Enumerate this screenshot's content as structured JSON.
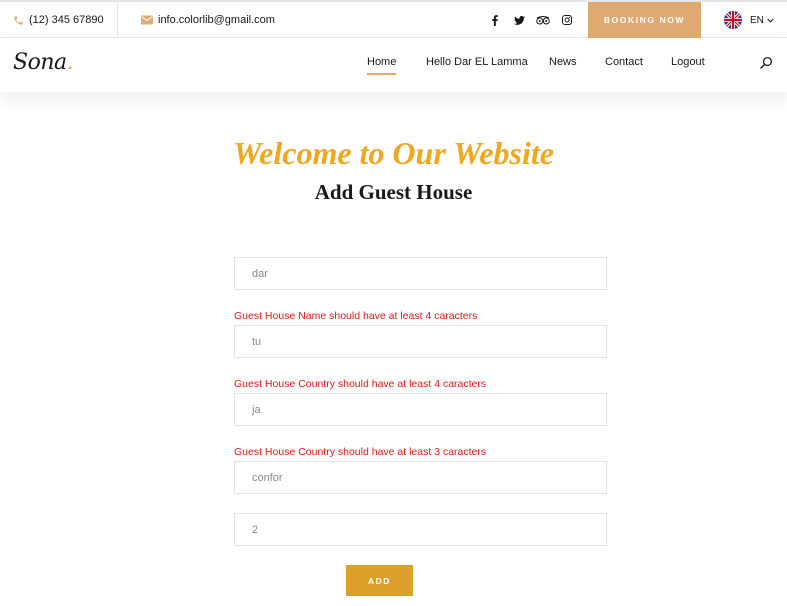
{
  "topbar": {
    "phone": "(12) 345 67890",
    "email": "info.colorlib@gmail.com",
    "social_icons": [
      "facebook-icon",
      "twitter-icon",
      "tripadvisor-icon",
      "instagram-icon"
    ],
    "booking_label": "BOOKING NOW",
    "language": "EN"
  },
  "nav": {
    "logo_text": "Sona",
    "logo_dot": ".",
    "items": [
      {
        "label": "Home",
        "active": true
      },
      {
        "label": "Hello Dar EL Lamma",
        "active": false
      },
      {
        "label": "News",
        "active": false
      },
      {
        "label": "Contact",
        "active": false
      },
      {
        "label": "Logout",
        "active": false
      }
    ]
  },
  "page": {
    "welcome": "Welcome to Our Website",
    "title": "Add Guest House"
  },
  "form": {
    "fields": [
      {
        "value": "dar"
      },
      {
        "value": "tu"
      },
      {
        "value": "ja"
      },
      {
        "value": "confor"
      },
      {
        "value": "2"
      }
    ],
    "errors": [
      "Guest House Name should have at least 4 caracters",
      "Guest House Country should have at least 4 caracters",
      "Guest House Country should have at least 3 caracters"
    ],
    "submit_label": "ADD"
  },
  "colors": {
    "accent": "#dfa974",
    "welcome": "#f0a71e",
    "error": "#e01a1a",
    "button": "#dd9f2b"
  }
}
